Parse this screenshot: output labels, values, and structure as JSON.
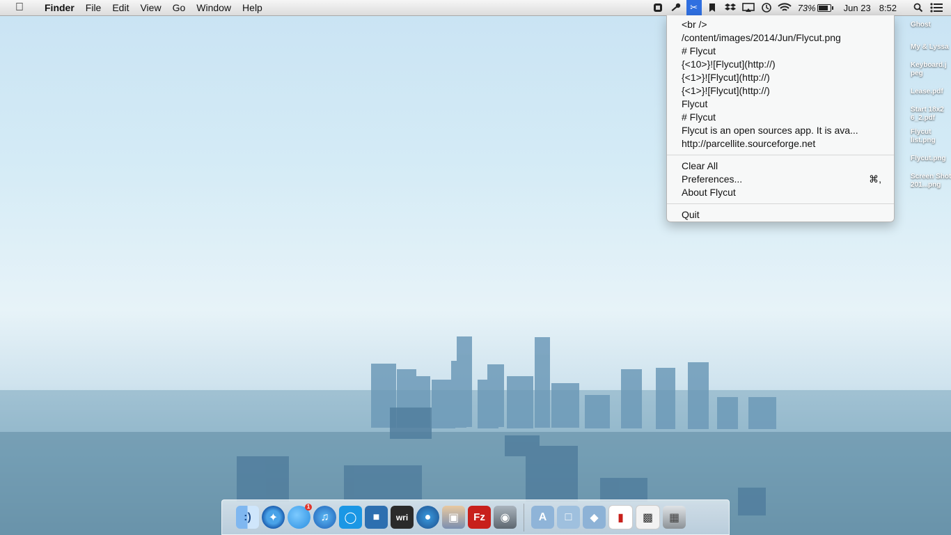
{
  "menubar": {
    "app_name": "Finder",
    "menus": [
      "File",
      "Edit",
      "View",
      "Go",
      "Window",
      "Help"
    ],
    "battery_percent": "73%",
    "date": "Jun 23",
    "time": "8:52",
    "status_icons": [
      "hat-icon",
      "key-icon",
      "scissors-icon",
      "bookmark-icon",
      "dropbox-icon",
      "airplay-icon",
      "time-machine-icon",
      "wifi-icon"
    ]
  },
  "flycut_menu": {
    "clippings": [
      "<br />",
      "/content/images/2014/Jun/Flycut.png",
      "# Flycut",
      "{<10>}![Flycut](http://)",
      "{<1>}![Flycut](http://)",
      "{<1>}![Flycut](http://)",
      "Flycut",
      "# Flycut",
      "Flycut is an open sources app. It is ava...",
      "http://parcellite.sourceforge.net"
    ],
    "clear_all": "Clear All",
    "preferences": "Preferences...",
    "preferences_shortcut": "⌘,",
    "about": "About Flycut",
    "quit": "Quit"
  },
  "desktop_files": [
    "Ghost",
    "My & Lyssa",
    "Keyboard.j peg",
    "Lease.pdf",
    "Start 18x2 6_2.pdf",
    "Flycut list.png",
    "Flycut.png",
    "Screen Shot 201...png"
  ],
  "dock": {
    "apps": [
      "finder-icon",
      "safari-icon",
      "messages-icon",
      "itunes-icon",
      "rdio-icon",
      "reeder-icon",
      "writer-icon",
      "tweetbot-icon",
      "preview-icon",
      "filezilla-icon",
      "facetime-icon"
    ],
    "folders": [
      "applications-folder-icon",
      "documents-folder-icon",
      "dropbox-folder-icon"
    ],
    "messages_badge": "1",
    "writer_label": "wri",
    "filezilla_label": "Fz"
  }
}
